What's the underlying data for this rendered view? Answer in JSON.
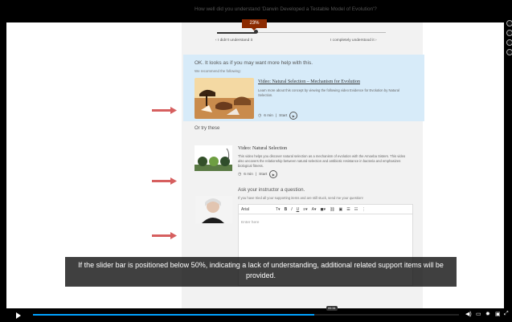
{
  "question": "How well did you understand 'Darwin Developed a Testable Model of Evolution'?",
  "slider": {
    "value_label": "23%",
    "value": 0.23,
    "left_label": "‹  I didn't understand it",
    "right_label": "I completely understood it  ›"
  },
  "help": {
    "heading": "OK. It looks as if you may want more help with this.",
    "recommend": "We recommend the following:",
    "item": {
      "title": "Video: Natural Selection – Mechanism for Evolution",
      "description": "Learn more about this concept by viewing the following video Evidence for Evolution by Natural Selection.",
      "duration": "6 min",
      "start": "Start"
    }
  },
  "or_try": "Or try these",
  "item2": {
    "title": "Video: Natural Selection",
    "description": "This video helps you discover natural selection as a mechanism of evolution with the Amoeba Sisters. This video also uncovers the relationship between natural selection and antibiotic resistance in bacteria and emphasizes biological fitness.",
    "duration": "6 min",
    "start": "Start"
  },
  "instructor": {
    "title": "Ask your instructor a question.",
    "subtitle": "If you have tried all your supporting items and are still stuck, send me your question!",
    "font": "Arial",
    "placeholder": "Enter here"
  },
  "caption": "If the slider bar is positioned below 50%, indicating a lack of understanding, additional related support items will be provided.",
  "video": {
    "progress": 0.66,
    "time": "00:34"
  },
  "colors": {
    "accent": "#8b2a00",
    "highlight": "#d7ebf9",
    "arrow": "#d65f5f"
  }
}
